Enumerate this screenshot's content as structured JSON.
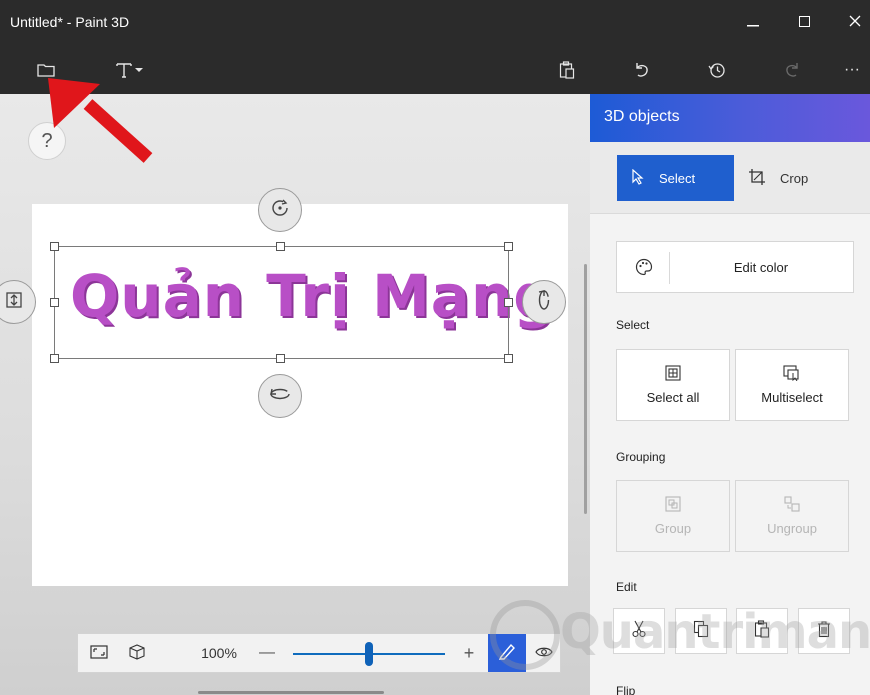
{
  "window": {
    "title": "Untitled* - Paint 3D",
    "minimize_icon": "minimize-icon",
    "maximize_icon": "maximize-icon",
    "close_icon": "close-icon"
  },
  "toolbar": {
    "left": [
      "folder-icon",
      "text-tool-icon",
      "dropdown-caret-icon"
    ],
    "right": [
      "paste-icon",
      "undo-icon",
      "history-icon",
      "redo-icon",
      "more-icon"
    ],
    "more_label": "···"
  },
  "canvas": {
    "help_label": "?",
    "art_text": "Quản Trị Mạng",
    "art_color": "#b84fc6"
  },
  "zoombar": {
    "zoom_value": "100%",
    "minus": "—",
    "plus": "+",
    "slider_level": 0.5
  },
  "panel": {
    "header": "3D objects",
    "select_label": "Select",
    "crop_label": "Crop",
    "edit_color_label": "Edit color",
    "select_section": "Select",
    "select_all_label": "Select all",
    "multiselect_label": "Multiselect",
    "grouping_section": "Grouping",
    "group_label": "Group",
    "ungroup_label": "Ungroup",
    "edit_section": "Edit",
    "flip_section": "Flip"
  },
  "colors": {
    "accent": "#1f5fce",
    "header_gradient_start": "#1d5bd6",
    "header_gradient_end": "#6a58dc",
    "annotation_arrow": "#e0161b"
  },
  "watermark": "Quantrimang"
}
